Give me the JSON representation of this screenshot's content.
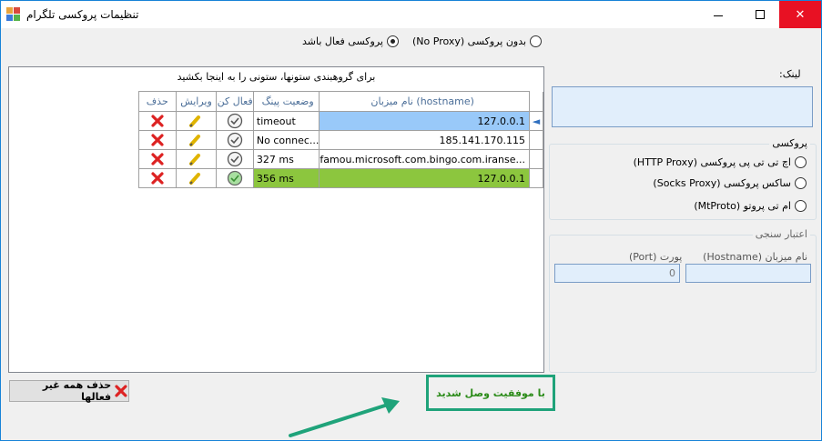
{
  "window": {
    "title": "تنظیمات پروکسی تلگرام",
    "min_glyph": "—",
    "close_glyph": "✕"
  },
  "top_options": {
    "no_proxy_label": "بدون پروکسی (No Proxy)",
    "proxy_enabled_label": "پروکسی فعال باشد",
    "selected": "proxy_enabled"
  },
  "grid": {
    "group_hint": "برای گروهبندی ستونها، ستونی را به اینجا بکشید",
    "columns": {
      "delete": "حذف",
      "edit": "ویرایش",
      "activate": "فعال کن",
      "ping": "وضعیت پینگ",
      "hostname": "نام میزبان (hostname)"
    },
    "rows": [
      {
        "ping": "timeout",
        "hostname": "127.0.0.1",
        "active": false,
        "selected": true
      },
      {
        "ping": "No connec...",
        "hostname": "185.141.170.115",
        "active": false,
        "selected": false
      },
      {
        "ping": "327 ms",
        "hostname": "famou.microsoft.com.bingo.com.iranse...",
        "active": false,
        "selected": false
      },
      {
        "ping": "356 ms",
        "hostname": "127.0.0.1",
        "active": true,
        "selected": false
      }
    ],
    "current_row_glyph": "◄"
  },
  "right_panel": {
    "link_label": "لینک:",
    "proxy_group_title": "پروکسی",
    "proxy_types": [
      "اچ تی تی پی پروکسی (HTTP Proxy)",
      "ساکس پروکسی (Socks Proxy)",
      "ام تی پروتو (MtProto)"
    ],
    "auth_group_title": "اعتبار سنجی",
    "hostname_label": "نام میزبان (Hostname)",
    "port_label": "پورت (Port)",
    "port_value": "0"
  },
  "bottom": {
    "delete_inactive_label": "حذف همه غیر فعالها",
    "status_message": "با موفقیت وصل شدید"
  },
  "colors": {
    "accent_blue": "#1883d7",
    "selected_row": "#99c9f9",
    "active_row": "#8cc63e",
    "status_border": "#1fa37a",
    "status_text": "#2c8c1a",
    "close_red": "#e81123"
  },
  "icons": {
    "delete": "red-x-icon",
    "edit": "pencil-icon",
    "activate": "checkmark-circle-icon"
  }
}
